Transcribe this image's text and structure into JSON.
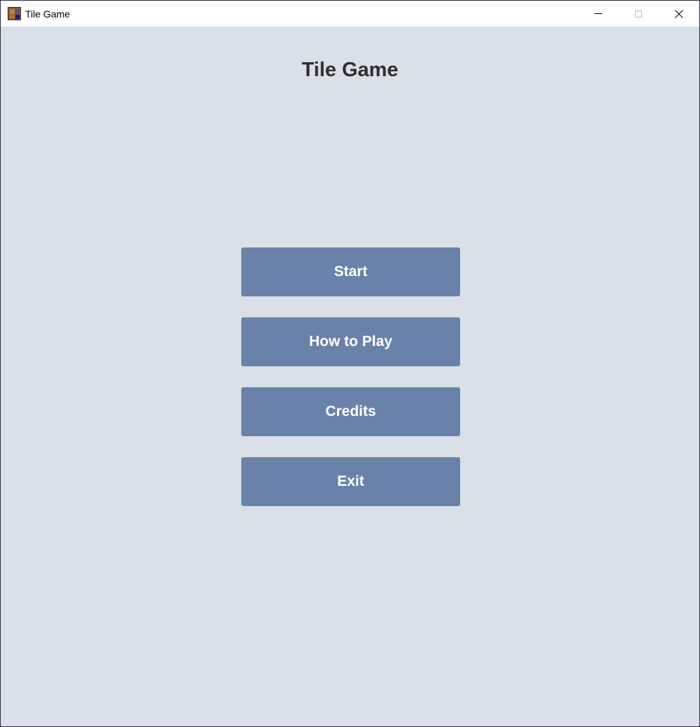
{
  "window": {
    "title": "Tile Game",
    "icon": "tile-game-app-icon",
    "controls": {
      "minimize_icon": "minimize-icon",
      "maximize_icon": "maximize-icon",
      "close_icon": "close-icon"
    }
  },
  "game": {
    "title": "Tile Game"
  },
  "menu": {
    "start_label": "Start",
    "how_to_play_label": "How to Play",
    "credits_label": "Credits",
    "exit_label": "Exit"
  },
  "colors": {
    "background": "#d9e0e8",
    "button": "#6a82aa",
    "button_text": "#ffffff",
    "title_text": "#2f2f2f"
  }
}
